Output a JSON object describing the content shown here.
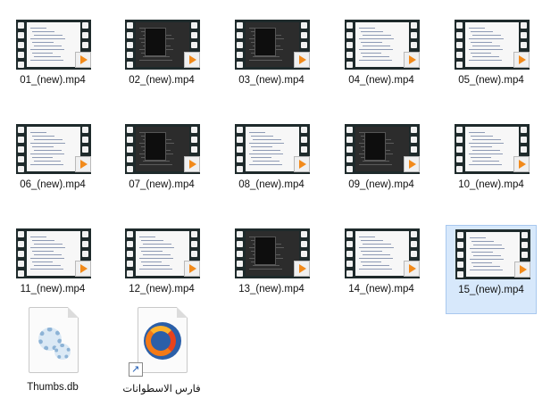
{
  "files": [
    {
      "name": "01_(new).mp4",
      "type": "video",
      "screen": "light",
      "selected": false
    },
    {
      "name": "02_(new).mp4",
      "type": "video",
      "screen": "dark",
      "selected": false
    },
    {
      "name": "03_(new).mp4",
      "type": "video",
      "screen": "dark",
      "selected": false
    },
    {
      "name": "04_(new).mp4",
      "type": "video",
      "screen": "light",
      "selected": false
    },
    {
      "name": "05_(new).mp4",
      "type": "video",
      "screen": "light",
      "selected": false
    },
    {
      "name": "06_(new).mp4",
      "type": "video",
      "screen": "light",
      "selected": false
    },
    {
      "name": "07_(new).mp4",
      "type": "video",
      "screen": "dark",
      "selected": false
    },
    {
      "name": "08_(new).mp4",
      "type": "video",
      "screen": "light",
      "selected": false
    },
    {
      "name": "09_(new).mp4",
      "type": "video",
      "screen": "dark",
      "selected": false
    },
    {
      "name": "10_(new).mp4",
      "type": "video",
      "screen": "light",
      "selected": false
    },
    {
      "name": "11_(new).mp4",
      "type": "video",
      "screen": "light",
      "selected": false
    },
    {
      "name": "12_(new).mp4",
      "type": "video",
      "screen": "light",
      "selected": false
    },
    {
      "name": "13_(new).mp4",
      "type": "video",
      "screen": "dark",
      "selected": false
    },
    {
      "name": "14_(new).mp4",
      "type": "video",
      "screen": "light",
      "selected": false
    },
    {
      "name": "15_(new).mp4",
      "type": "video",
      "screen": "light",
      "selected": true
    },
    {
      "name": "Thumbs.db",
      "type": "system-file",
      "selected": false
    },
    {
      "name": "فارس الاسطوانات",
      "type": "firefox-shortcut",
      "selected": false
    }
  ],
  "icons": {
    "video": "video-file-icon",
    "play_badge": "play-badge-icon",
    "system": "system-file-gears-icon",
    "firefox": "firefox-icon",
    "shortcut": "shortcut-arrow-icon"
  },
  "colors": {
    "selection_fill": "#d7e8fb",
    "selection_border": "#a8c8ef",
    "film": "#1e2a2b",
    "play_orange": "#f28a1a"
  }
}
